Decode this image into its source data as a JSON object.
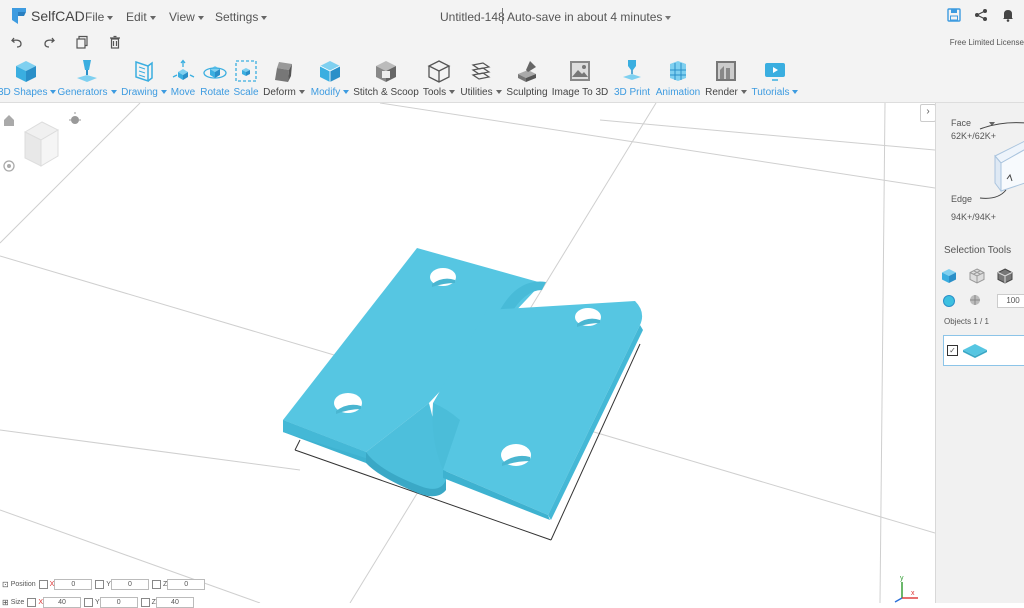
{
  "app": {
    "name": "SelfCAD"
  },
  "menu": {
    "file": "File",
    "edit": "Edit",
    "view": "View",
    "settings": "Settings"
  },
  "document": {
    "title": "Untitled-148",
    "autosave": "Auto-save in about 4 minutes"
  },
  "license": "Free Limited License",
  "toolbar": {
    "shapes": "3D Shapes",
    "generators": "Generators",
    "drawing": "Drawing",
    "move": "Move",
    "rotate": "Rotate",
    "scale": "Scale",
    "deform": "Deform",
    "modify": "Modify",
    "stitch": "Stitch & Scoop",
    "tools": "Tools",
    "utilities": "Utilities",
    "sculpting": "Sculpting",
    "image_to_3d": "Image To 3D",
    "print": "3D Print",
    "animation": "Animation",
    "render": "Render",
    "tutorials": "Tutorials"
  },
  "right_panel": {
    "face_label": "Face",
    "face_count": "62K+/62K+",
    "edge_label": "Edge",
    "edge_count": "94K+/94K+",
    "selection_tools": "Selection Tools",
    "brush_size": "100",
    "objects": "Objects 1 / 1"
  },
  "transform": {
    "position_label": "Position",
    "size_label": "Size",
    "axis_x": "X",
    "axis_y": "Y",
    "axis_z": "Z",
    "pos_x": "0",
    "pos_y": "0",
    "pos_z": "0",
    "size_x": "40",
    "size_y": "0",
    "size_z": "40"
  },
  "colors": {
    "accent": "#3d9be0",
    "model": "#56c6e2",
    "toolbar_bg": "#f3f3f3"
  },
  "icons": [
    "undo-icon",
    "redo-icon",
    "copy-icon",
    "delete-icon",
    "save-icon",
    "share-icon",
    "bell-icon"
  ]
}
